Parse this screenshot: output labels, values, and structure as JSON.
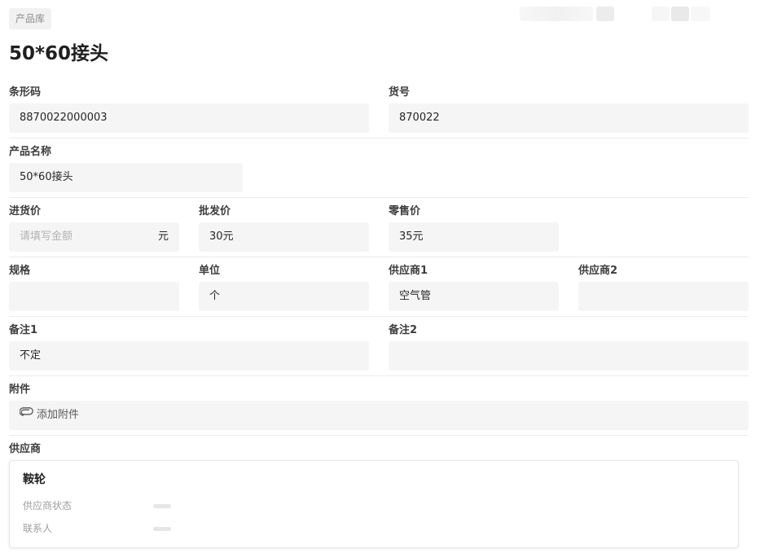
{
  "tag": "产品库",
  "title": "50*60接头",
  "fields": {
    "barcode": {
      "label": "条形码",
      "value": "8870022000003"
    },
    "item_no": {
      "label": "货号",
      "value": "870022"
    },
    "name": {
      "label": "产品名称",
      "value": "50*60接头"
    },
    "purchase_price": {
      "label": "进货价",
      "placeholder": "请填写金额",
      "unit": "元"
    },
    "wholesale_price": {
      "label": "批发价",
      "value": "30元"
    },
    "retail_price": {
      "label": "零售价",
      "value": "35元"
    },
    "spec": {
      "label": "规格",
      "value": ""
    },
    "unit": {
      "label": "单位",
      "value": "个"
    },
    "supplier1": {
      "label": "供应商1",
      "value": "空气管"
    },
    "supplier2": {
      "label": "供应商2",
      "value": ""
    },
    "remark1": {
      "label": "备注1",
      "value": "不定"
    },
    "remark2": {
      "label": "备注2",
      "value": ""
    },
    "attachment": {
      "label": "附件",
      "button": "添加附件",
      "icon": "paperclip-icon"
    }
  },
  "supplier_section": {
    "label": "供应商",
    "card": {
      "name": "鞍轮",
      "status_label": "供应商状态",
      "contact_label": "联系人"
    }
  }
}
